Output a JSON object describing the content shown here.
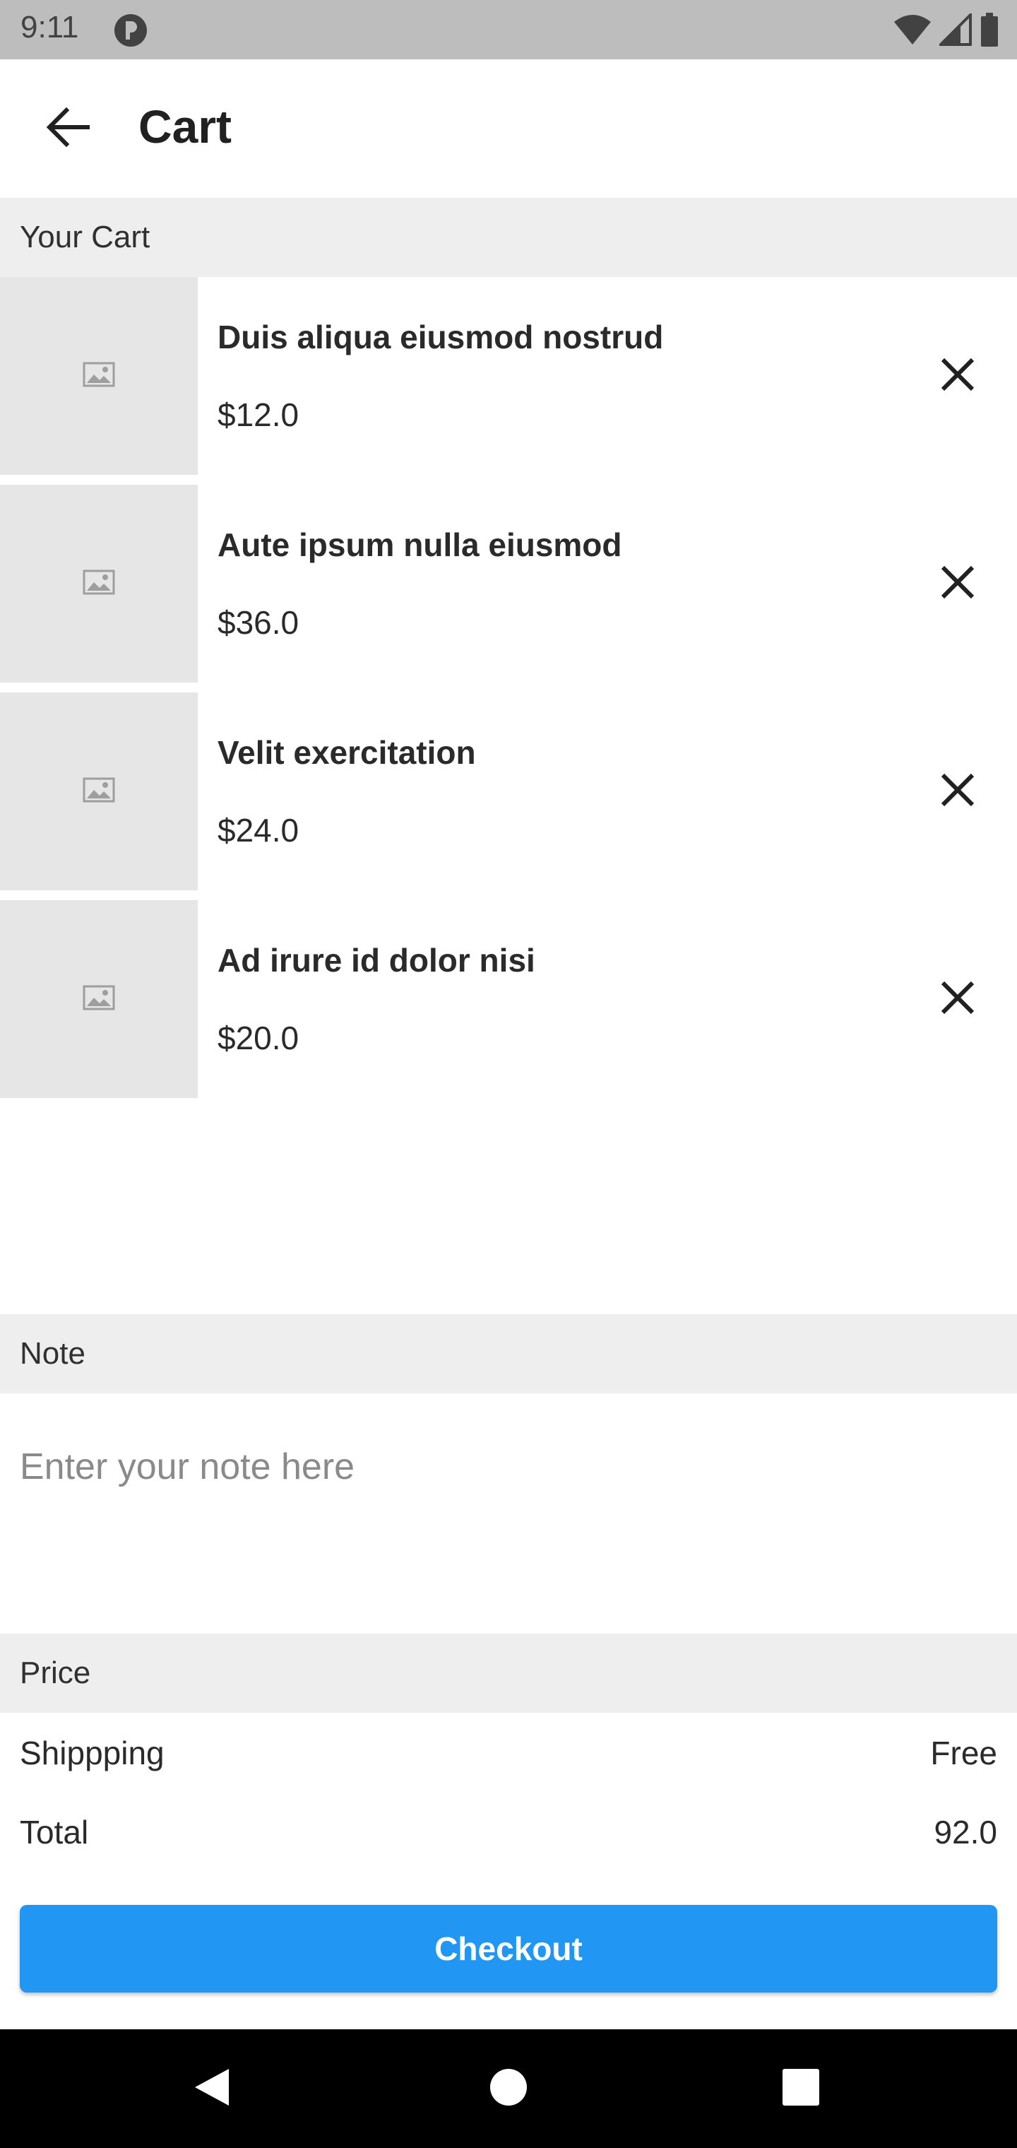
{
  "status_bar": {
    "time": "9:11",
    "icons": [
      "notification-app-icon",
      "wifi-icon",
      "signal-icon",
      "battery-icon"
    ]
  },
  "app_bar": {
    "title": "Cart",
    "back_icon": "arrow-back-icon"
  },
  "cart": {
    "header": "Your Cart",
    "items": [
      {
        "name": "Duis aliqua eiusmod nostrud",
        "price": "$12.0",
        "image_icon": "image-placeholder-icon",
        "remove_icon": "close-icon"
      },
      {
        "name": "Aute ipsum nulla eiusmod",
        "price": "$36.0",
        "image_icon": "image-placeholder-icon",
        "remove_icon": "close-icon"
      },
      {
        "name": "Velit exercitation",
        "price": "$24.0",
        "image_icon": "image-placeholder-icon",
        "remove_icon": "close-icon"
      },
      {
        "name": "Ad irure id dolor nisi",
        "price": "$20.0",
        "image_icon": "image-placeholder-icon",
        "remove_icon": "close-icon"
      }
    ]
  },
  "note": {
    "header": "Note",
    "value": "",
    "placeholder": "Enter your note here"
  },
  "price": {
    "header": "Price",
    "shipping_label": "Shippping",
    "shipping_value": "Free",
    "total_label": "Total",
    "total_value": "92.0"
  },
  "checkout": {
    "label": "Checkout"
  },
  "nav_bar": {
    "icons": [
      "nav-back-icon",
      "nav-home-icon",
      "nav-recents-icon"
    ]
  },
  "colors": {
    "accent": "#2196f3",
    "section_header_bg": "#eeeeee",
    "thumb_bg": "#e6e6e6",
    "status_bar_bg": "#bdbdbd"
  }
}
